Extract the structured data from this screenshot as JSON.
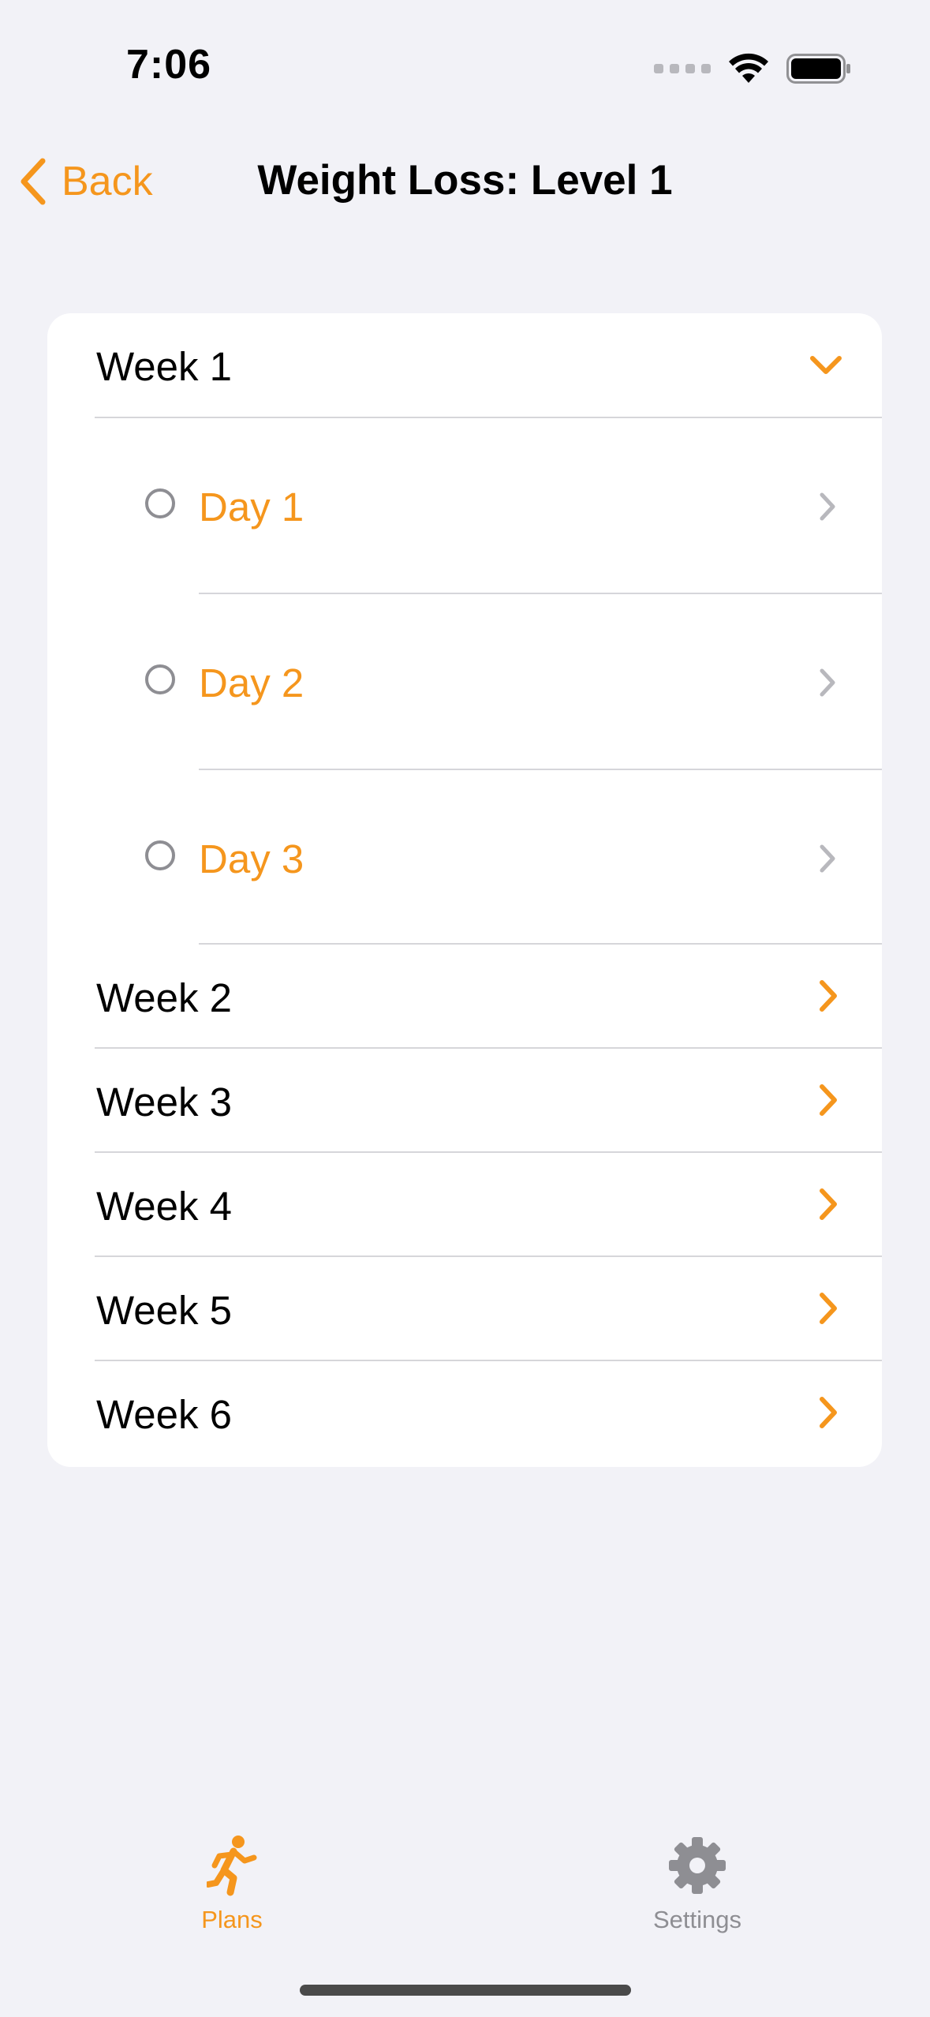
{
  "status_bar": {
    "time": "7:06"
  },
  "nav": {
    "back_label": "Back",
    "title": "Weight Loss: Level 1"
  },
  "weeks": [
    {
      "label": "Week 1",
      "expanded": true,
      "days": [
        {
          "label": "Day 1",
          "completed": false
        },
        {
          "label": "Day 2",
          "completed": false
        },
        {
          "label": "Day 3",
          "completed": false
        }
      ]
    },
    {
      "label": "Week 2",
      "expanded": false
    },
    {
      "label": "Week 3",
      "expanded": false
    },
    {
      "label": "Week 4",
      "expanded": false
    },
    {
      "label": "Week 5",
      "expanded": false
    },
    {
      "label": "Week 6",
      "expanded": false
    }
  ],
  "tabs": [
    {
      "label": "Plans",
      "icon": "running-figure-icon",
      "selected": true
    },
    {
      "label": "Settings",
      "icon": "gear-icon",
      "selected": false
    }
  ],
  "colors": {
    "accent": "#f5961d",
    "background": "#f2f2f7",
    "inactive": "#8e8e93"
  }
}
